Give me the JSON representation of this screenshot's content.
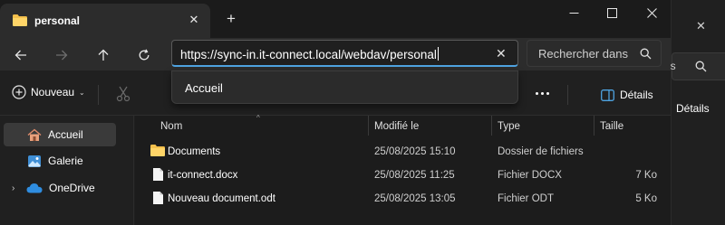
{
  "window": {
    "tab_title": "personal",
    "tab_close_glyph": "✕",
    "new_tab_glyph": "+",
    "minimize_icon": "minimize-icon",
    "maximize_icon": "maximize-icon",
    "close_icon": "close-icon"
  },
  "navigation": {
    "back_icon": "arrow-left-icon",
    "forward_icon": "arrow-right-icon",
    "up_icon": "arrow-up-icon",
    "refresh_icon": "refresh-icon",
    "address_value": "https://sync-in.it-connect.local/webdav/personal",
    "address_clear_glyph": "✕",
    "search_placeholder": "Rechercher dans",
    "search_icon": "search-icon"
  },
  "address_suggestions": [
    "Accueil"
  ],
  "toolbar": {
    "new_label": "Nouveau",
    "new_chevron": "⌄",
    "details_label": "Détails"
  },
  "sidebar": {
    "items": [
      {
        "label": "Accueil",
        "icon": "home-icon",
        "active": true
      },
      {
        "label": "Galerie",
        "icon": "gallery-icon",
        "active": false
      },
      {
        "label": "OneDrive",
        "icon": "cloud-icon",
        "active": false,
        "expand_glyph": "›"
      }
    ]
  },
  "file_list": {
    "sort_glyph": "^",
    "columns": [
      "Nom",
      "Modifié le",
      "Type",
      "Taille"
    ],
    "rows": [
      {
        "name": "Documents",
        "modified": "25/08/2025 15:10",
        "type": "Dossier de fichiers",
        "size": "",
        "icon": "folder-icon"
      },
      {
        "name": "it-connect.docx",
        "modified": "25/08/2025 11:25",
        "type": "Fichier DOCX",
        "size": "7 Ko",
        "icon": "document-icon"
      },
      {
        "name": "Nouveau document.odt",
        "modified": "25/08/2025 13:05",
        "type": "Fichier ODT",
        "size": "5 Ko",
        "icon": "document-icon"
      }
    ]
  },
  "background_window": {
    "close_glyph": "✕",
    "search_fragment": "ns",
    "details_label": "Détails"
  },
  "colors": {
    "accent": "#4ea3e0",
    "folder": "#f4c04c",
    "background": "#202020"
  }
}
